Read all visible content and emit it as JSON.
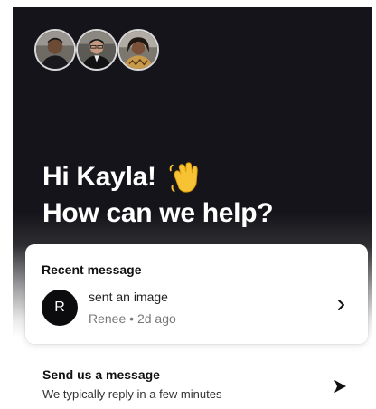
{
  "header": {
    "greeting_line1": "Hi Kayla!",
    "greeting_line2": "How can we help?",
    "wave_icon": "waving-hand-icon",
    "avatars": [
      "team-avatar-1",
      "team-avatar-2",
      "team-avatar-3"
    ]
  },
  "recent": {
    "title": "Recent message",
    "avatar_initial": "R",
    "message": "sent an image",
    "sender": "Renee",
    "separator": "•",
    "time": "2d ago",
    "chevron_icon": "chevron-right-icon"
  },
  "send": {
    "title": "Send us a message",
    "subtitle": "We typically reply in a few minutes",
    "icon": "send-arrow-icon"
  },
  "colors": {
    "hero_bg": "#15141a",
    "text_on_dark": "#ffffff",
    "avatar_bg": "#0c0c0e"
  }
}
